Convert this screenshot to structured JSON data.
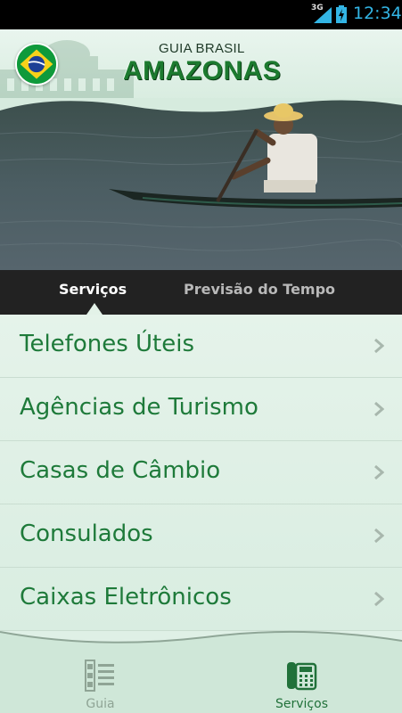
{
  "status_bar": {
    "network": "3G",
    "time": "12:34"
  },
  "header": {
    "brand_top": "GUIA BRASIL",
    "brand_main": "AMAZONAS"
  },
  "tabs": [
    {
      "label": "Serviços",
      "active": true
    },
    {
      "label": "Previsão do Tempo",
      "active": false
    }
  ],
  "list": {
    "items": [
      {
        "label": "Telefones Úteis"
      },
      {
        "label": "Agências de Turismo"
      },
      {
        "label": "Casas de Câmbio"
      },
      {
        "label": "Consulados"
      },
      {
        "label": "Caixas Eletrônicos"
      }
    ]
  },
  "bottom_nav": [
    {
      "label": "Guia",
      "icon": "guide-list-icon",
      "active": false
    },
    {
      "label": "Serviços",
      "icon": "phone-icon",
      "active": true
    }
  ],
  "colors": {
    "accent_green": "#1e7a3a",
    "clock_blue": "#33b5e5",
    "tab_bar": "#222222"
  }
}
